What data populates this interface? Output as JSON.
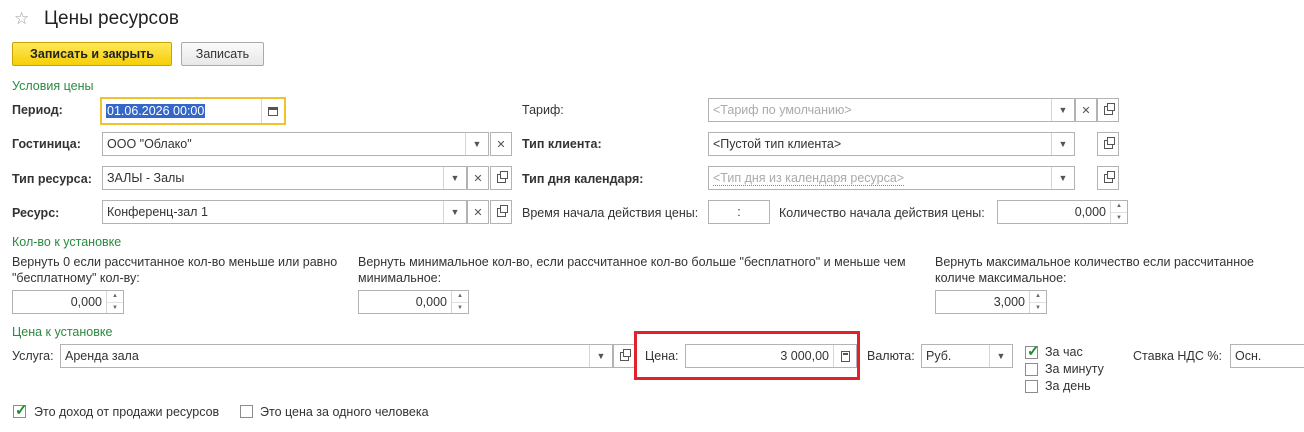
{
  "header": {
    "title": "Цены ресурсов"
  },
  "toolbar": {
    "save_close_label": "Записать и закрыть",
    "save_label": "Записать"
  },
  "sections": {
    "conditions": "Условия цены",
    "quantity": "Кол-во к установке",
    "price": "Цена к установке"
  },
  "conditions": {
    "period_label": "Период:",
    "period_value": "01.06.2026 00:00",
    "hotel_label": "Гостиница:",
    "hotel_value": "ООО \"Облако\"",
    "resource_type_label": "Тип ресурса:",
    "resource_type_value": "ЗАЛЫ - Залы",
    "resource_label": "Ресурс:",
    "resource_value": "Конференц-зал 1",
    "tariff_label": "Тариф:",
    "tariff_placeholder": "<Тариф по умолчанию>",
    "client_type_label": "Тип клиента:",
    "client_type_value": "<Пустой тип клиента>",
    "calendar_day_label": "Тип дня календаря:",
    "calendar_day_placeholder": "<Тип дня из календаря ресурса>",
    "start_time_label": "Время начала действия цены:",
    "start_time_value": ":",
    "start_qty_label": "Количество начала действия цены:",
    "start_qty_value": "0,000"
  },
  "quantity": {
    "q1_label": "Вернуть 0 если рассчитанное кол-во меньше или равно \"бесплатному\" кол-ву:",
    "q1_value": "0,000",
    "q2_label": "Вернуть минимальное кол-во, если рассчитанное кол-во больше \"бесплатного\" и меньше чем минимальное:",
    "q2_value": "0,000",
    "q3_label": "Вернуть максимальное количество если рассчитанное количе максимальное:",
    "q3_value": "3,000"
  },
  "price": {
    "service_label": "Услуга:",
    "service_value": "Аренда зала",
    "price_label": "Цена:",
    "price_value": "3 000,00",
    "currency_label": "Валюта:",
    "currency_value": "Руб.",
    "per_hour": "За час",
    "per_minute": "За минуту",
    "per_day": "За день",
    "per_hour_checked": true,
    "per_minute_checked": false,
    "per_day_checked": false,
    "vat_label": "Ставка НДС %:",
    "vat_value": "Осн."
  },
  "footer": {
    "income_label": "Это доход от продажи ресурсов",
    "income_checked": true,
    "per_person_label": "Это цена за одного человека",
    "per_person_checked": false
  },
  "colors": {
    "primary_button": "#f5cf07",
    "section_title": "#2a8a3e",
    "highlight": "#e1212b",
    "focus": "#f2c12e"
  }
}
